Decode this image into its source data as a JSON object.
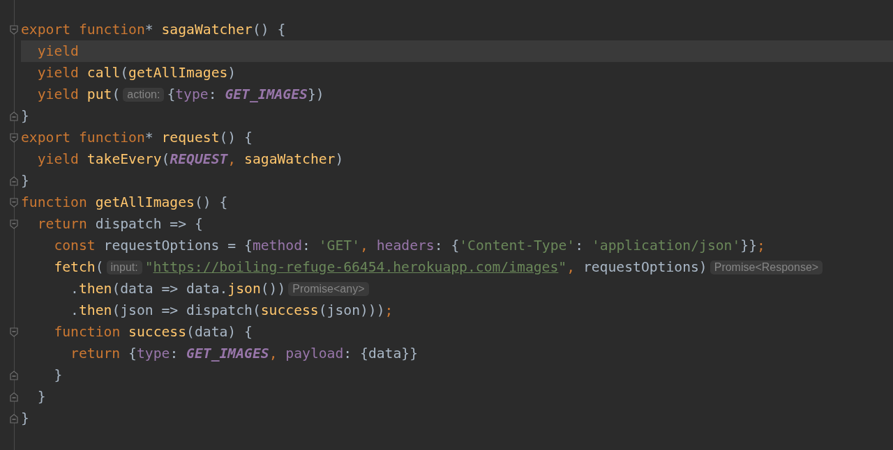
{
  "editor": {
    "lines": [
      {
        "fold_open": true,
        "fold_close": false,
        "current": false,
        "tokens": [
          {
            "kind": "kw",
            "text": "export function"
          },
          {
            "kind": "plain",
            "text": "* "
          },
          {
            "kind": "fn",
            "text": "sagaWatcher"
          },
          {
            "kind": "plain",
            "text": "() {"
          }
        ],
        "children": [
          {
            "fold_open": false,
            "fold_close": false,
            "current": true,
            "tokens": [
              {
                "kind": "kw",
                "text": "yield"
              }
            ]
          },
          {
            "fold_open": false,
            "fold_close": false,
            "current": false,
            "tokens": [
              {
                "kind": "kw",
                "text": "yield "
              },
              {
                "kind": "fn",
                "text": "call"
              },
              {
                "kind": "plain",
                "text": "("
              },
              {
                "kind": "fn",
                "text": "getAllImages"
              },
              {
                "kind": "plain",
                "text": ")"
              }
            ]
          },
          {
            "fold_open": false,
            "fold_close": false,
            "current": false,
            "tokens": [
              {
                "kind": "kw",
                "text": "yield "
              },
              {
                "kind": "fn",
                "text": "put"
              },
              {
                "kind": "plain",
                "text": "("
              },
              {
                "kind": "hint",
                "text": "action:"
              },
              {
                "kind": "plain",
                "text": "{"
              },
              {
                "kind": "prop",
                "text": "type"
              },
              {
                "kind": "plain",
                "text": ": "
              },
              {
                "kind": "const",
                "text": "GET_IMAGES"
              },
              {
                "kind": "plain",
                "text": "})"
              }
            ]
          }
        ]
      },
      {
        "fold_open": false,
        "fold_close": true,
        "current": false,
        "tokens": [
          {
            "kind": "plain",
            "text": "}"
          }
        ]
      },
      {
        "fold_open": true,
        "fold_close": false,
        "current": false,
        "tokens": [
          {
            "kind": "kw",
            "text": "export function"
          },
          {
            "kind": "plain",
            "text": "* "
          },
          {
            "kind": "fn",
            "text": "request"
          },
          {
            "kind": "plain",
            "text": "() {"
          }
        ],
        "children": [
          {
            "fold_open": false,
            "fold_close": false,
            "current": false,
            "tokens": [
              {
                "kind": "kw",
                "text": "yield "
              },
              {
                "kind": "fn",
                "text": "takeEvery"
              },
              {
                "kind": "plain",
                "text": "("
              },
              {
                "kind": "const",
                "text": "REQUEST"
              },
              {
                "kind": "punct",
                "text": ", "
              },
              {
                "kind": "fn",
                "text": "sagaWatcher"
              },
              {
                "kind": "plain",
                "text": ")"
              }
            ]
          }
        ]
      },
      {
        "fold_open": false,
        "fold_close": true,
        "current": false,
        "tokens": [
          {
            "kind": "plain",
            "text": "}"
          }
        ]
      },
      {
        "fold_open": true,
        "fold_close": false,
        "current": false,
        "tokens": [
          {
            "kind": "kw",
            "text": "function "
          },
          {
            "kind": "fn",
            "text": "getAllImages"
          },
          {
            "kind": "plain",
            "text": "() {"
          }
        ],
        "children": [
          {
            "fold_open": true,
            "fold_close": false,
            "current": false,
            "tokens": [
              {
                "kind": "kw",
                "text": "return "
              },
              {
                "kind": "plain",
                "text": "dispatch => {"
              }
            ],
            "children": [
              {
                "fold_open": false,
                "fold_close": false,
                "current": false,
                "tokens": [
                  {
                    "kind": "kw",
                    "text": "const "
                  },
                  {
                    "kind": "plain",
                    "text": "requestOptions = {"
                  },
                  {
                    "kind": "prop",
                    "text": "method"
                  },
                  {
                    "kind": "plain",
                    "text": ": "
                  },
                  {
                    "kind": "str",
                    "text": "'GET'"
                  },
                  {
                    "kind": "punct",
                    "text": ", "
                  },
                  {
                    "kind": "prop",
                    "text": "headers"
                  },
                  {
                    "kind": "plain",
                    "text": ": {"
                  },
                  {
                    "kind": "str",
                    "text": "'Content-Type'"
                  },
                  {
                    "kind": "plain",
                    "text": ": "
                  },
                  {
                    "kind": "str",
                    "text": "'application/json'"
                  },
                  {
                    "kind": "plain",
                    "text": "}}"
                  },
                  {
                    "kind": "punct",
                    "text": ";"
                  }
                ]
              },
              {
                "fold_open": false,
                "fold_close": false,
                "current": false,
                "tokens": [
                  {
                    "kind": "fn",
                    "text": "fetch"
                  },
                  {
                    "kind": "plain",
                    "text": "("
                  },
                  {
                    "kind": "hint",
                    "text": "input:"
                  },
                  {
                    "kind": "str",
                    "text": "\""
                  },
                  {
                    "kind": "link",
                    "text": "https://boiling-refuge-66454.herokuapp.com/images"
                  },
                  {
                    "kind": "str",
                    "text": "\""
                  },
                  {
                    "kind": "punct",
                    "text": ", "
                  },
                  {
                    "kind": "plain",
                    "text": "requestOptions)"
                  },
                  {
                    "kind": "hint",
                    "text": "Promise<Response>"
                  }
                ],
                "children": [
                  {
                    "fold_open": false,
                    "fold_close": false,
                    "current": false,
                    "tokens": [
                      {
                        "kind": "member",
                        "text": ".then"
                      },
                      {
                        "kind": "plain",
                        "text": "(data => data."
                      },
                      {
                        "kind": "fn",
                        "text": "json"
                      },
                      {
                        "kind": "plain",
                        "text": "())"
                      },
                      {
                        "kind": "hint",
                        "text": "Promise<any>"
                      }
                    ]
                  },
                  {
                    "fold_open": false,
                    "fold_close": false,
                    "current": false,
                    "tokens": [
                      {
                        "kind": "member",
                        "text": ".then"
                      },
                      {
                        "kind": "plain",
                        "text": "(json => dispatch("
                      },
                      {
                        "kind": "fn",
                        "text": "success"
                      },
                      {
                        "kind": "plain",
                        "text": "(json)))"
                      },
                      {
                        "kind": "punct",
                        "text": ";"
                      }
                    ]
                  }
                ]
              },
              {
                "fold_open": true,
                "fold_close": false,
                "current": false,
                "tokens": [
                  {
                    "kind": "kw",
                    "text": "function "
                  },
                  {
                    "kind": "fn",
                    "text": "success"
                  },
                  {
                    "kind": "plain",
                    "text": "(data) {"
                  }
                ],
                "children": [
                  {
                    "fold_open": false,
                    "fold_close": false,
                    "current": false,
                    "tokens": [
                      {
                        "kind": "kw",
                        "text": "return "
                      },
                      {
                        "kind": "plain",
                        "text": "{"
                      },
                      {
                        "kind": "prop",
                        "text": "type"
                      },
                      {
                        "kind": "plain",
                        "text": ": "
                      },
                      {
                        "kind": "const",
                        "text": "GET_IMAGES"
                      },
                      {
                        "kind": "punct",
                        "text": ", "
                      },
                      {
                        "kind": "prop",
                        "text": "payload"
                      },
                      {
                        "kind": "plain",
                        "text": ": {data}}"
                      }
                    ]
                  }
                ]
              },
              {
                "fold_open": false,
                "fold_close": true,
                "current": false,
                "tokens": [
                  {
                    "kind": "plain",
                    "text": "}"
                  }
                ]
              }
            ]
          },
          {
            "fold_open": false,
            "fold_close": true,
            "current": false,
            "tokens": [
              {
                "kind": "plain",
                "text": "}"
              }
            ]
          }
        ]
      },
      {
        "fold_open": false,
        "fold_close": true,
        "current": false,
        "tokens": [
          {
            "kind": "plain",
            "text": "}"
          }
        ]
      }
    ]
  }
}
